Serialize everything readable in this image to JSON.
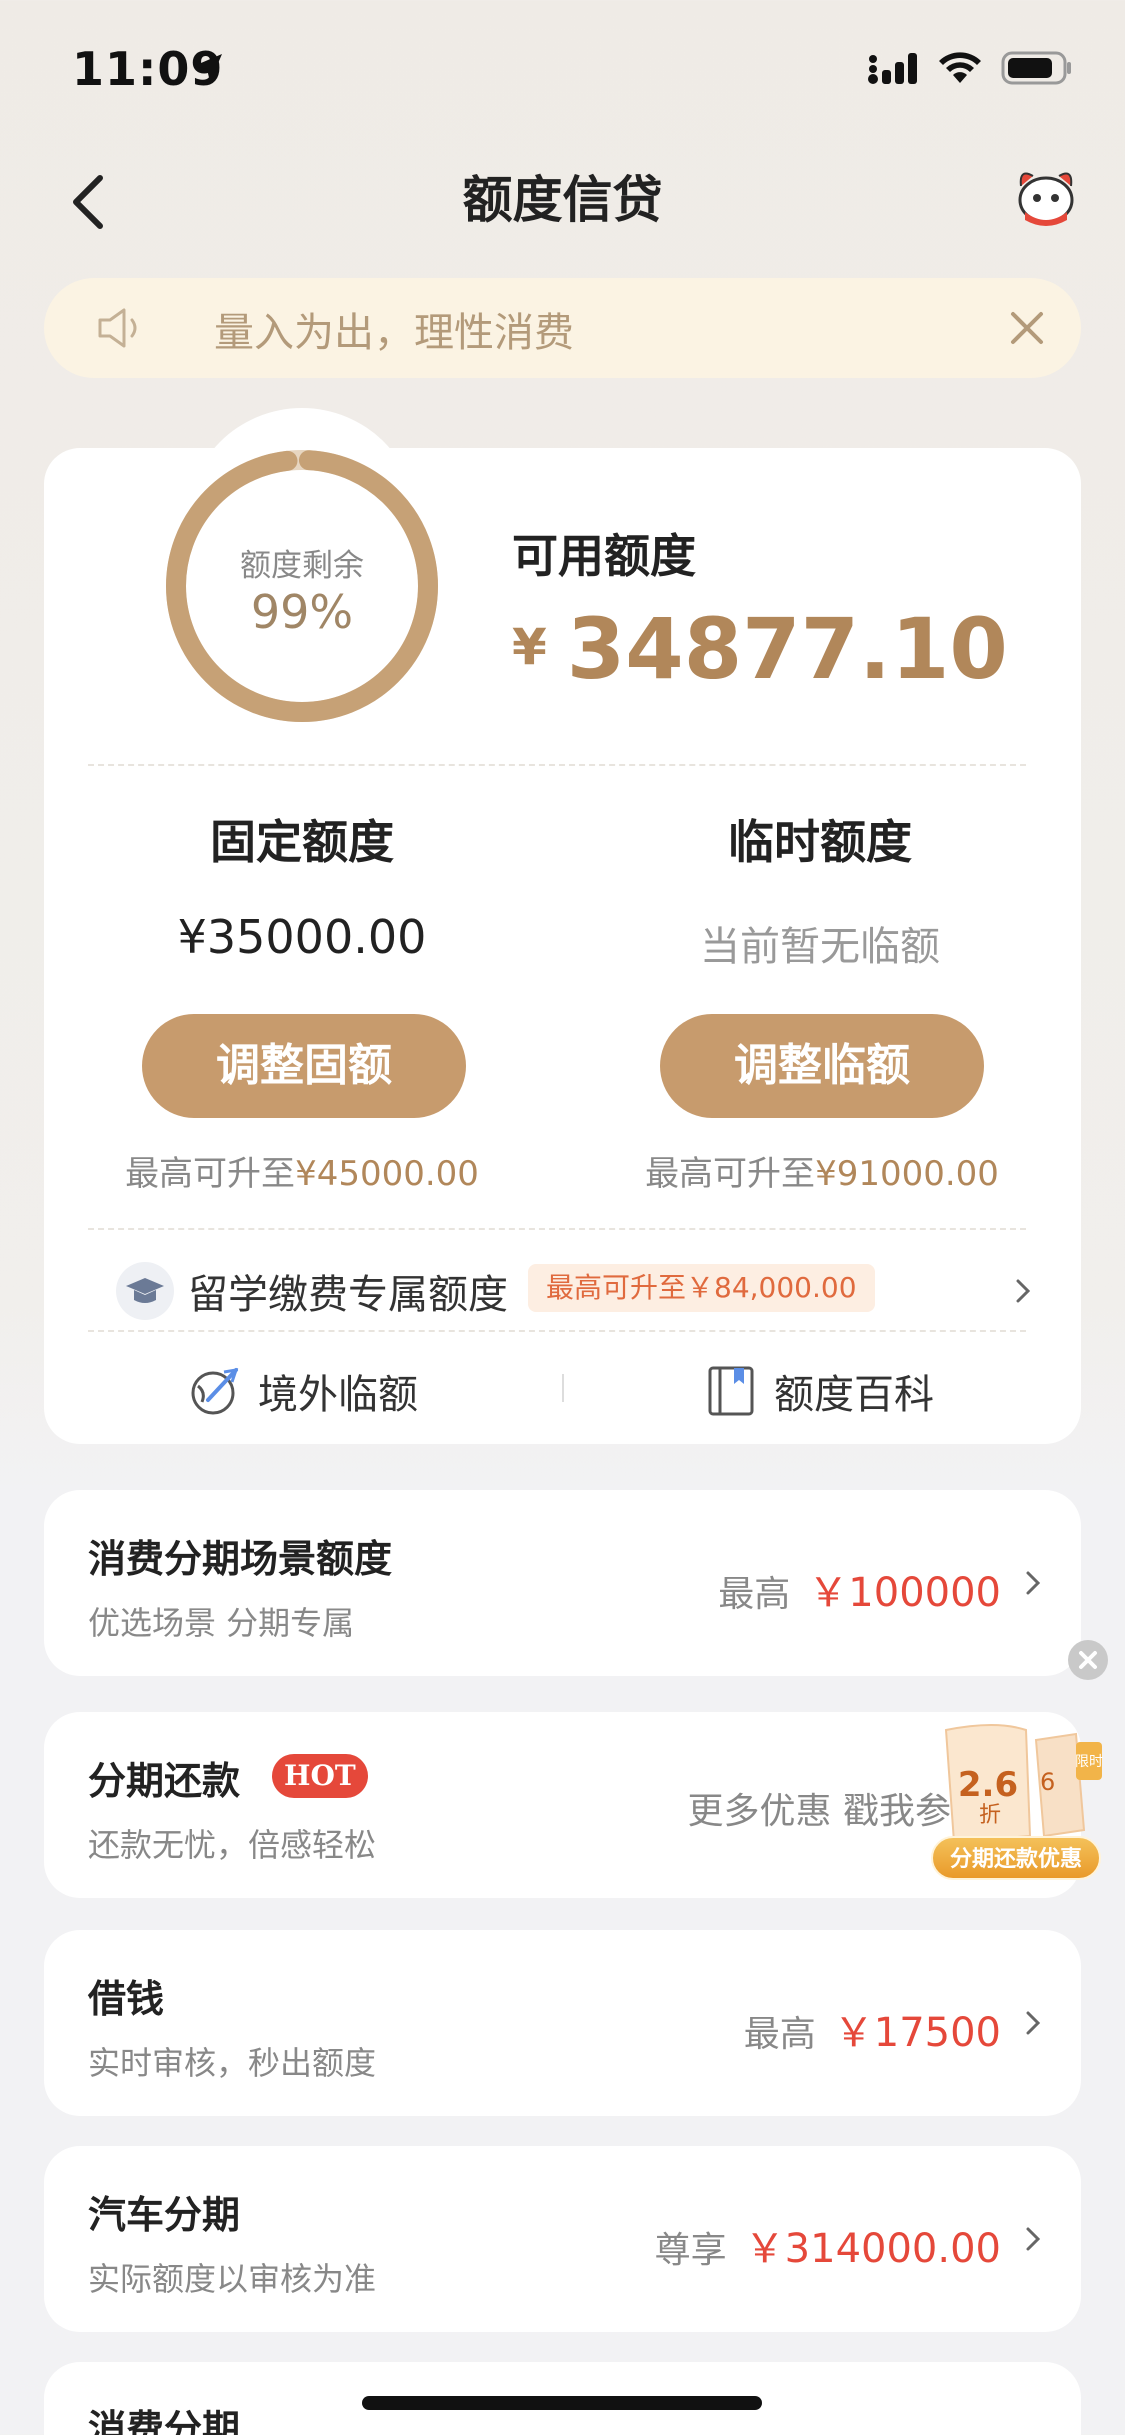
{
  "status_bar": {
    "time": "11:09"
  },
  "nav": {
    "title": "额度信贷"
  },
  "notice": {
    "text": "量入为出，理性消费"
  },
  "credit": {
    "gauge_label": "额度剩余",
    "gauge_percent": "99%",
    "gauge_fraction": 0.99,
    "available_label": "可用额度",
    "available_currency": "¥",
    "available_amount": "34877.10"
  },
  "fixed": {
    "title": "固定额度",
    "amount": "¥35000.00",
    "button": "调整固额",
    "max_prefix": "最高可升至",
    "max_value": "¥45000.00"
  },
  "temporary": {
    "title": "临时额度",
    "status": "当前暂无临额",
    "button": "调整临额",
    "max_prefix": "最高可升至",
    "max_value": "¥91000.00"
  },
  "study_abroad": {
    "label": "留学缴费专属额度",
    "badge": "最高可升至￥84,000.00"
  },
  "quick_links": [
    {
      "label": "境外临额",
      "icon": "globe-plane-icon"
    },
    {
      "label": "额度百科",
      "icon": "book-icon"
    }
  ],
  "list": [
    {
      "title": "消费分期场景额度",
      "subtitle": "优选场景 分期专属",
      "prefix": "最高",
      "amount": "￥100000"
    },
    {
      "title": "分期还款",
      "badge": "HOT",
      "subtitle": "还款无忧，倍感轻松",
      "right_text": "更多优惠 戳我参"
    },
    {
      "title": "借钱",
      "subtitle": "实时审核，秒出额度",
      "prefix": "最高",
      "amount": "￥17500"
    },
    {
      "title": "汽车分期",
      "subtitle": "实际额度以审核为准",
      "prefix": "尊享",
      "amount": "￥314000.00"
    },
    {
      "title": "消费分期"
    }
  ],
  "promo": {
    "discount": "2.6",
    "unit": "折",
    "second": "6",
    "tag": "限时",
    "label": "分期还款优惠"
  },
  "colors": {
    "gold": "#b1875a",
    "button": "#c79b6d",
    "red": "#e5483a"
  }
}
